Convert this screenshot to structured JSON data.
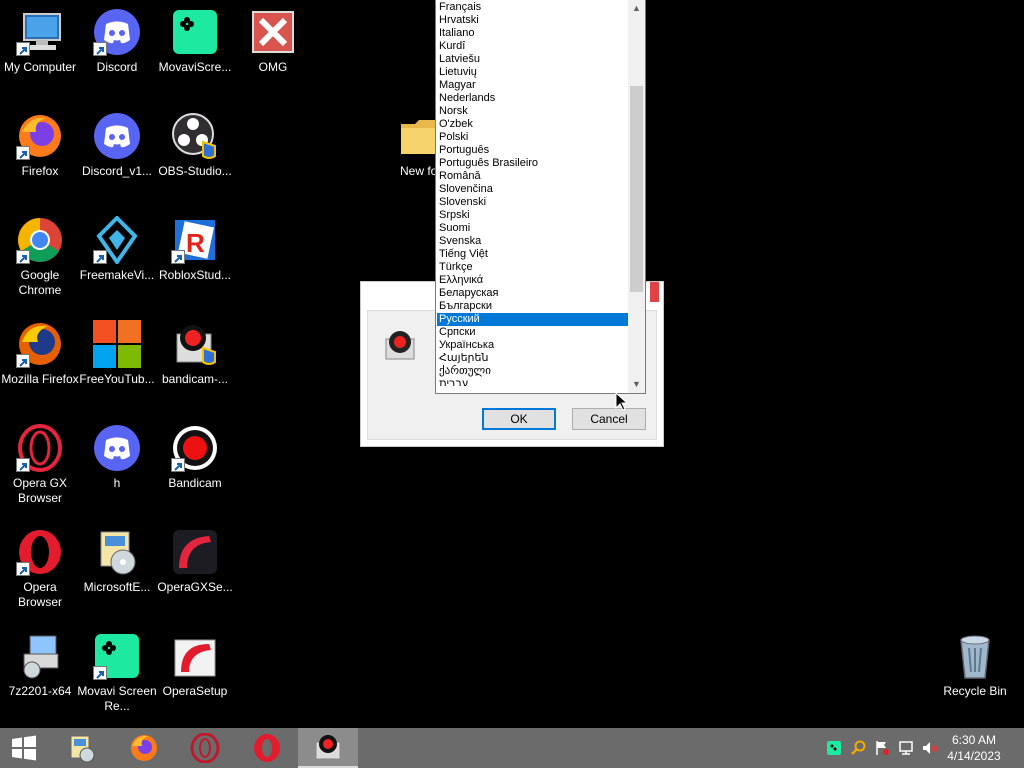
{
  "desktop": {
    "icons": [
      {
        "label": "My Computer",
        "icon": "computer-icon"
      },
      {
        "label": "Discord",
        "icon": "discord-icon"
      },
      {
        "label": "MovaviScre...",
        "icon": "movavi-icon"
      },
      {
        "label": "OMG",
        "icon": "omg-x-icon"
      },
      {
        "label": "Firefox",
        "icon": "firefox-icon"
      },
      {
        "label": "Discord_v1...",
        "icon": "discord-icon"
      },
      {
        "label": "OBS-Studio...",
        "icon": "obs-icon"
      },
      {
        "label": "Google Chrome",
        "icon": "chrome-icon"
      },
      {
        "label": "FreemakeVi...",
        "icon": "freemake-icon"
      },
      {
        "label": "RobloxStud...",
        "icon": "roblox-icon"
      },
      {
        "label": "Mozilla Firefox",
        "icon": "firefox-icon"
      },
      {
        "label": "FreeYouTub...",
        "icon": "windows-tiles-icon"
      },
      {
        "label": "bandicam-...",
        "icon": "bandicam-installer-icon"
      },
      {
        "label": "Opera GX Browser",
        "icon": "opera-gx-icon"
      },
      {
        "label": "h",
        "icon": "discord-icon"
      },
      {
        "label": "Bandicam",
        "icon": "bandicam-icon"
      },
      {
        "label": "Opera Browser",
        "icon": "opera-icon"
      },
      {
        "label": "MicrosoftE...",
        "icon": "installer-icon"
      },
      {
        "label": "OperaGXSe...",
        "icon": "operagx-setup-icon"
      },
      {
        "label": "7z2201-x64",
        "icon": "7zip-installer-icon"
      },
      {
        "label": "Movavi Screen Re...",
        "icon": "movavi-icon"
      },
      {
        "label": "OperaSetup",
        "icon": "opera-setup-icon"
      },
      {
        "label": "Recycle Bin",
        "icon": "recycle-bin-icon"
      },
      {
        "label": "New fo",
        "icon": "folder-icon"
      }
    ]
  },
  "language_list": {
    "items": [
      "Français",
      "Hrvatski",
      "Italiano",
      "Kurdî",
      "Latviešu",
      "Lietuvių",
      "Magyar",
      "Nederlands",
      "Norsk",
      "O'zbek",
      "Polski",
      "Português",
      "Português Brasileiro",
      "Română",
      "Slovenčina",
      "Slovenski",
      "Srpski",
      "Suomi",
      "Svenska",
      "Tiếng Việt",
      "Türkçe",
      "Ελληνικά",
      "Беларуская",
      "Български",
      "Русский",
      "Српски",
      "Українська",
      "Հայերեն",
      "ქართული",
      "עברית"
    ],
    "selected": "Русский"
  },
  "dialog": {
    "ok_label": "OK",
    "cancel_label": "Cancel"
  },
  "taskbar": {
    "time": "6:30 AM",
    "date": "4/14/2023",
    "pinned": [
      "start-icon",
      "installer-icon",
      "firefox-icon",
      "opera-gx-icon",
      "opera-icon",
      "bandicam-installer-icon"
    ]
  },
  "colors": {
    "selection": "#0078d7",
    "taskbar": "#6b6b6b",
    "desktop": "#000000"
  }
}
